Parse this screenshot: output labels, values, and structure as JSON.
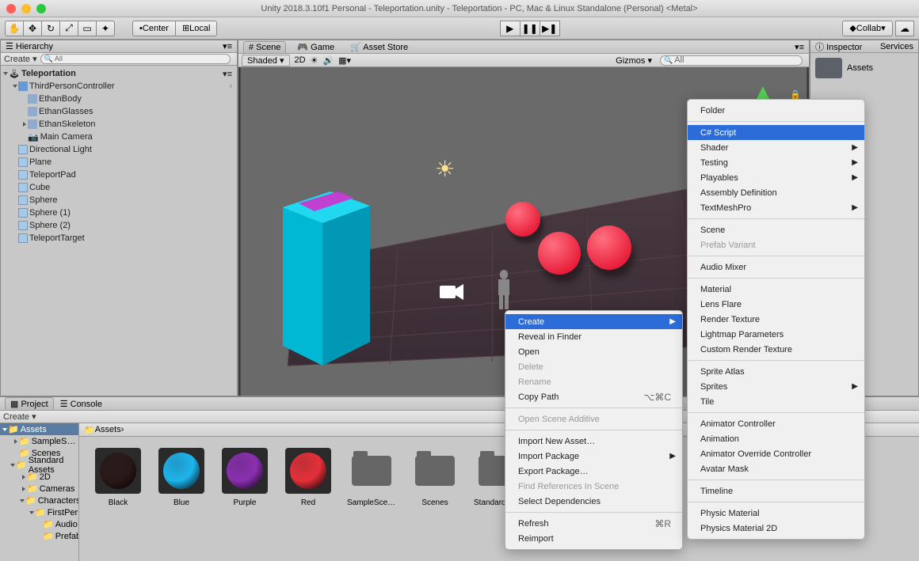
{
  "title": "Unity 2018.3.10f1 Personal - Teleportation.unity - Teleportation - PC, Mac & Linux Standalone (Personal) <Metal>",
  "toolbar": {
    "center": "Center",
    "local": "Local",
    "collab": "Collab"
  },
  "hierarchy": {
    "tab": "Hierarchy",
    "create": "Create",
    "scene": "Teleportation",
    "nodes": [
      {
        "name": "ThirdPersonController",
        "children": [
          "EthanBody",
          "EthanGlasses",
          "EthanSkeleton",
          "Main Camera"
        ]
      },
      {
        "name": "Directional Light"
      },
      {
        "name": "Plane"
      },
      {
        "name": "TeleportPad"
      },
      {
        "name": "Cube"
      },
      {
        "name": "Sphere"
      },
      {
        "name": "Sphere (1)"
      },
      {
        "name": "Sphere (2)"
      },
      {
        "name": "TeleportTarget"
      }
    ]
  },
  "center": {
    "tabs": [
      "# Scene",
      "Game",
      "Asset Store"
    ],
    "shaded": "Shaded",
    "twod": "2D",
    "gizmos": "Gizmos",
    "all": "All"
  },
  "inspector": {
    "tab": "Inspector",
    "services": "Services",
    "assets": "Assets"
  },
  "project": {
    "tab": "Project",
    "console": "Console",
    "create": "Create",
    "crumbAssets": "Assets",
    "tree": [
      "Assets",
      "SampleScenes",
      "Scenes",
      "Standard Assets",
      "2D",
      "Cameras",
      "Characters",
      "FirstPerson",
      "Audio",
      "Prefabs"
    ],
    "items": [
      {
        "label": "Black",
        "type": "mat",
        "color": "#2a1818"
      },
      {
        "label": "Blue",
        "type": "mat",
        "color": "#1db4ec"
      },
      {
        "label": "Purple",
        "type": "mat",
        "color": "#8a2fb0"
      },
      {
        "label": "Red",
        "type": "mat",
        "color": "#e4303a"
      },
      {
        "label": "SampleScenes",
        "type": "folder"
      },
      {
        "label": "Scenes",
        "type": "folder"
      },
      {
        "label": "Standard Assets",
        "type": "folder"
      }
    ]
  },
  "ctx1": {
    "create": "Create",
    "reveal": "Reveal in Finder",
    "open": "Open",
    "delete": "Delete",
    "rename": "Rename",
    "copypath": "Copy Path",
    "copypath_sc": "⌥⌘C",
    "openadd": "Open Scene Additive",
    "importnew": "Import New Asset…",
    "importpkg": "Import Package",
    "exportpkg": "Export Package…",
    "findref": "Find References In Scene",
    "seldep": "Select Dependencies",
    "refresh": "Refresh",
    "refresh_sc": "⌘R",
    "reimport": "Reimport"
  },
  "ctx2": {
    "folder": "Folder",
    "csharp": "C# Script",
    "shader": "Shader",
    "testing": "Testing",
    "playables": "Playables",
    "asmdef": "Assembly Definition",
    "tmp": "TextMeshPro",
    "scene": "Scene",
    "prefabvar": "Prefab Variant",
    "audiomixer": "Audio Mixer",
    "material": "Material",
    "lensflare": "Lens Flare",
    "rendertex": "Render Texture",
    "lightmap": "Lightmap Parameters",
    "customrt": "Custom Render Texture",
    "spriteatlas": "Sprite Atlas",
    "sprites": "Sprites",
    "tile": "Tile",
    "animctrl": "Animator Controller",
    "anim": "Animation",
    "animover": "Animator Override Controller",
    "avatar": "Avatar Mask",
    "timeline": "Timeline",
    "physmat": "Physic Material",
    "physmat2d": "Physics Material 2D"
  }
}
